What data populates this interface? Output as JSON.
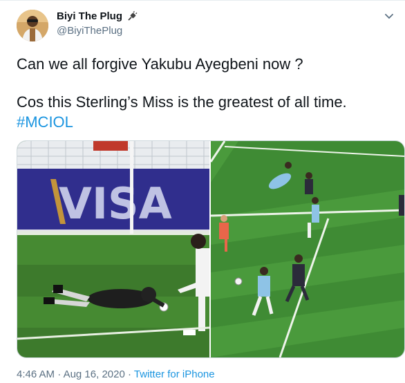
{
  "author": {
    "name": "Biyi The Plug",
    "handle": "@BiyiThePlug",
    "name_emoji_icon": "electric-plug-icon"
  },
  "tweet": {
    "line1": "Can we all forgive Yakubu Ayegbeni now ?",
    "line2": "Cos this Sterling’s Miss is the greatest of all time.",
    "hashtag": "#MCIOL"
  },
  "media": {
    "left_image_ad_text": "VISA",
    "left_image_description_icon": "goalkeeper-photo",
    "right_image_description_icon": "football-match-photo"
  },
  "meta": {
    "time": "4:46 AM",
    "separator": " · ",
    "date": "Aug 16, 2020",
    "source": "Twitter for iPhone"
  },
  "colors": {
    "link": "#1b95e0",
    "muted": "#5b7083",
    "text": "#0f1419"
  }
}
